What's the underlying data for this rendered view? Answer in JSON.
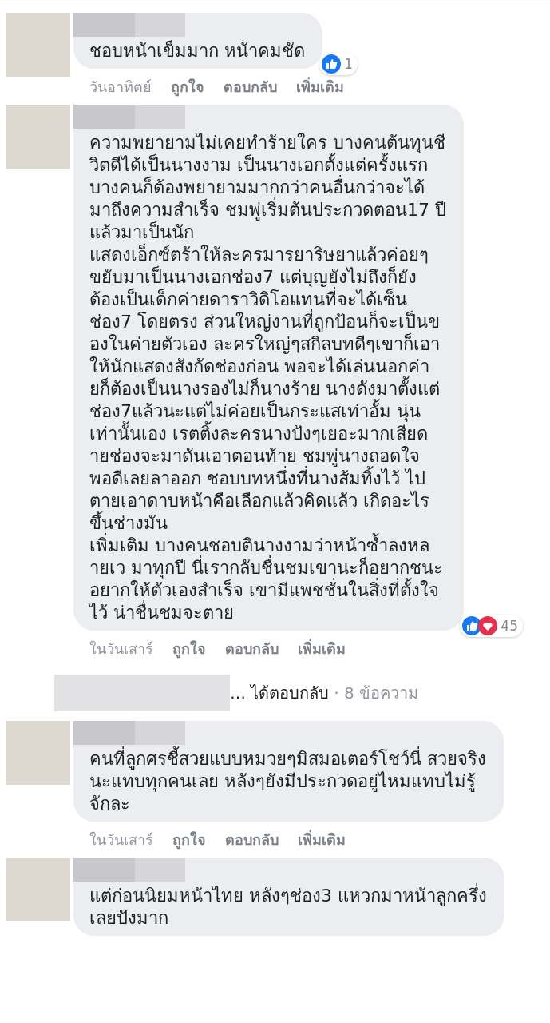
{
  "items": [
    {
      "kind": "comment",
      "lines": [
        "ชอบหน้าเข็มมาก หน้าคมชัด"
      ],
      "reactions": [
        {
          "kind": "like"
        }
      ],
      "reaction_count": "1",
      "time": "วันอาทิตย์",
      "actions": [
        "ถูกใจ",
        "ตอบกลับ",
        "เพิ่มเติม"
      ]
    },
    {
      "kind": "comment",
      "lines": [
        "ความพยายามไม่เคยทำร้ายใคร บางคนต้นทุนชี",
        "วิตดีได้เป็นนางงาม เป็นนางเอกตั้งแต่ครั้งแรก",
        "บางคนก็ต้องพยายามมากกว่าคนอื่นกว่าจะได้",
        "มาถึงความสำเร็จ ชมพู่เริ่มต้นประกวดตอน17 ปี",
        "แล้วมาเป็นนัก",
        "แสดงเอ็กซ์ตร้าให้ละครมารยาริษยาแล้วค่อยๆ",
        "ขยับมาเป็นนางเอกช่อง7 แต่บุญยังไม่ถึงก็ยัง",
        "ต้องเป็นเด็กค่ายดาราวิดิโอแทนที่จะได้เซ็น",
        "ช่อง7 โดยตรง ส่วนใหญ่งานที่ถูกป้อนก็จะเป็นข",
        "องในค่ายตัวเอง ละครใหญ่ๆสกิลบทดีๆเขาก็เอา",
        "ให้นักแสดงสังกัดช่องก่อน พอจะได้เล่นนอกค่า",
        "ยก็ต้องเป็นนางรองไม่ก็นางร้าย นางดังมาตั้งแต่",
        "ช่อง7แล้วนะแต่ไม่ค่อยเป็นกระแสเท่าอั้ม นุ่น",
        "เท่านั้นเอง เรตติ้งละครนางปังๆเยอะมากเสียด",
        "ายช่องจะมาดันเอาตอนท้าย ชมพู่นางถอดใจ",
        "พอดีเลยลาออก ชอบบทหนึ่งที่นางส้มทิ้งไว้ ไป",
        "ตายเอาดาบหน้าคือเลือกแล้วคิดแล้ว เกิดอะไร",
        "ขึ้นช่างมัน",
        "เพิ่มเติม บางคนชอบตินางงามว่าหน้าซ้ำลงหล",
        "ายเว มาทุกปี นี่เรากลับชื่นชมเขานะก็อยากชนะ",
        "อยากให้ตัวเองสำเร็จ เขามีแพชชั่นในสิ่งที่ตั้งใจ",
        "ไว้ น่าชื่นชมจะตาย"
      ],
      "reactions": [
        {
          "kind": "like"
        },
        {
          "kind": "love"
        }
      ],
      "reaction_count": "45",
      "time": "ในวันเสาร์",
      "actions": [
        "ถูกใจ",
        "ตอบกลับ",
        "เพิ่มเติม"
      ]
    },
    {
      "kind": "replies",
      "text": "… ได้ตอบกลับ",
      "count": "· 8 ข้อความ"
    },
    {
      "kind": "comment",
      "lines": [
        "คนที่ลูกศรชี้สวยแบบหมวยๆมิสมอเตอร์โชว์นี่ สวยจริง",
        "นะแทบทุกคนเลย หลังๆยังมีประกวดอยู่ไหมแทบไม่รู้",
        "จักละ"
      ],
      "time": "ในวันเสาร์",
      "actions": [
        "ถูกใจ",
        "ตอบกลับ",
        "เพิ่มเติม"
      ]
    },
    {
      "kind": "comment",
      "lines": [
        "แต่ก่อนนิยมหน้าไทย หลังๆช่อง3 แหวกมาหน้าลูกครึ่ง",
        "เลยปังมาก"
      ]
    }
  ]
}
